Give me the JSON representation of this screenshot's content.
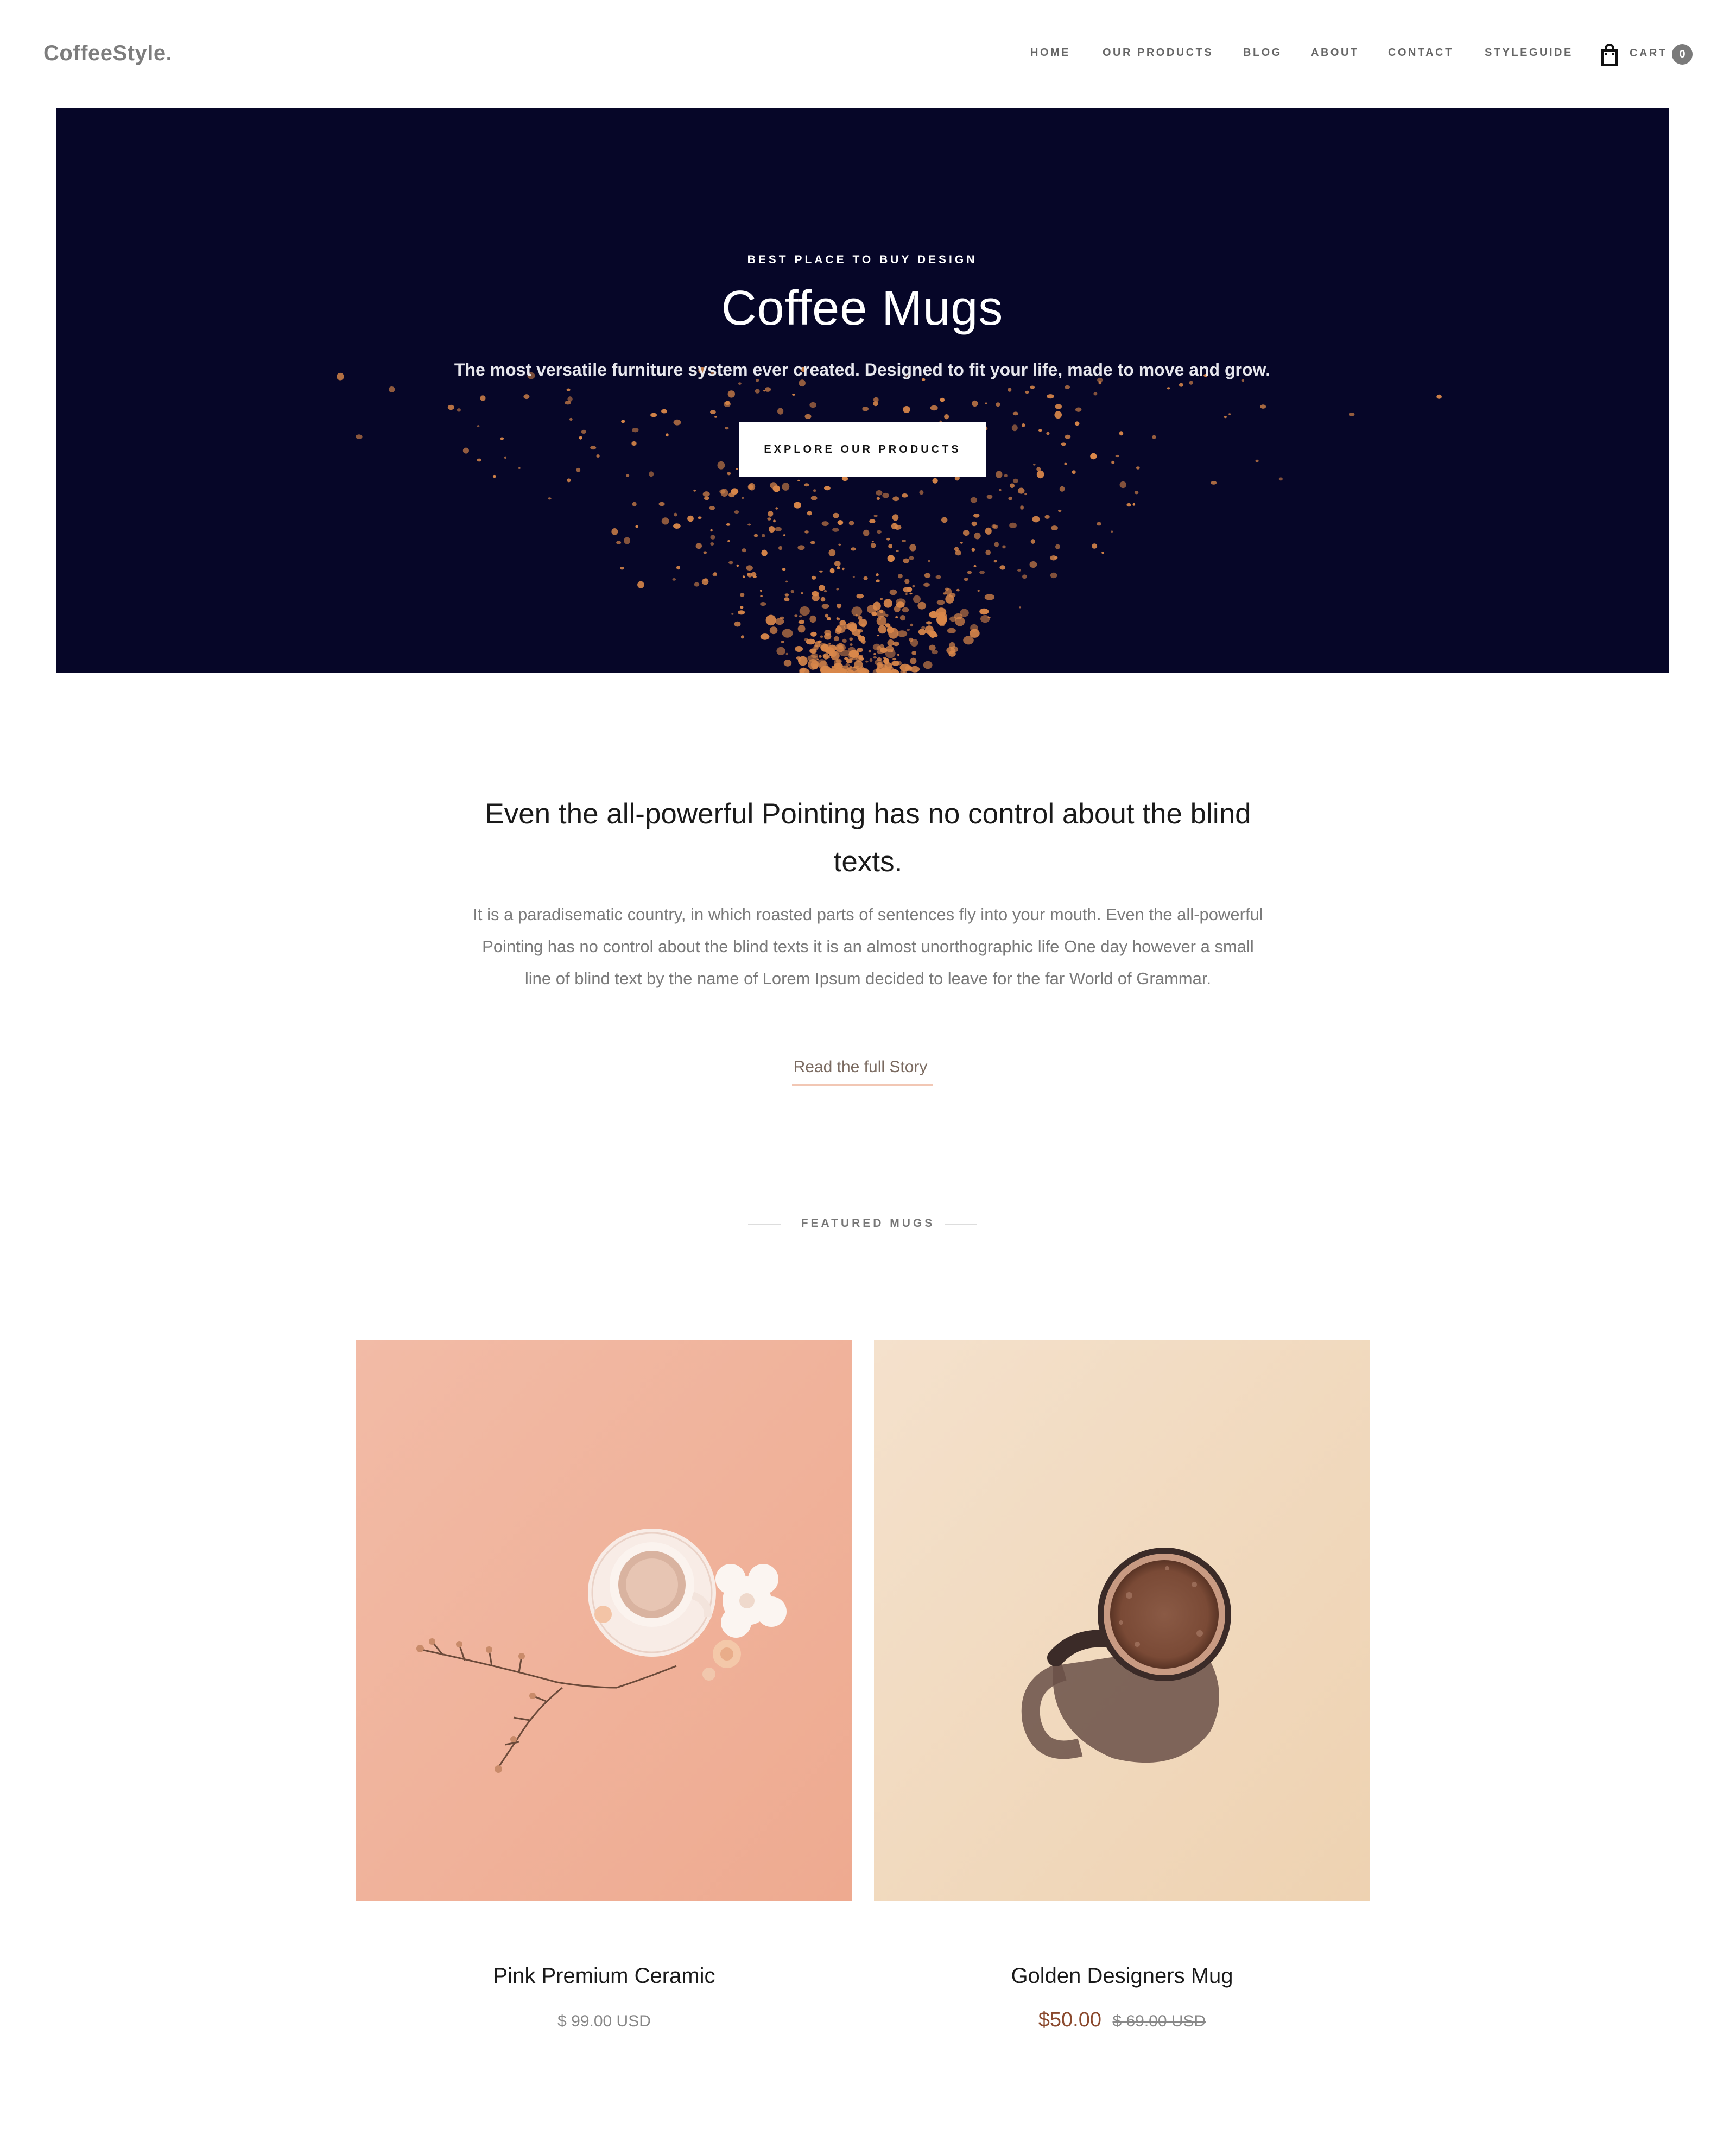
{
  "site": {
    "logo": "CoffeeStyle.",
    "nav": [
      "HOME",
      "OUR PRODUCTS",
      "BLOG",
      "ABOUT",
      "CONTACT",
      "STYLEGUIDE"
    ],
    "cart_label": "CART",
    "cart_count": "0"
  },
  "hero": {
    "kicker": "BEST PLACE TO BUY DESIGN",
    "title": "Coffee Mugs",
    "subtitle": "The most versatile furniture system ever created. Designed to fit your life, made to move and grow.",
    "button": "EXPLORE OUR PRODUCTS",
    "background_color": "#060628",
    "particle_color": "#d9874a"
  },
  "intro": {
    "heading": "Even the all-powerful Pointing has no control about the blind texts.",
    "body": "It is a paradisematic country, in which roasted parts of sentences fly into your mouth. Even the all-powerful Pointing has no control about the blind texts it is an almost unorthographic life One day however a small line of blind text by the name of Lorem Ipsum decided to leave for the far World of Grammar.",
    "link": "Read the full Story"
  },
  "featured": {
    "title": "FEATURED MUGS",
    "products": [
      {
        "name": "Pink Premium Ceramic",
        "price": "$ 99.00 USD"
      },
      {
        "name": "Golden Designers Mug",
        "sale_price": "$50.00",
        "old_price": "$ 69.00 USD"
      }
    ]
  },
  "colors": {
    "accent": "#8b4a2e",
    "link_underline": "#f2c7b4",
    "pink_card": "#f0b9a4",
    "gold_card": "#f2dcc3"
  }
}
